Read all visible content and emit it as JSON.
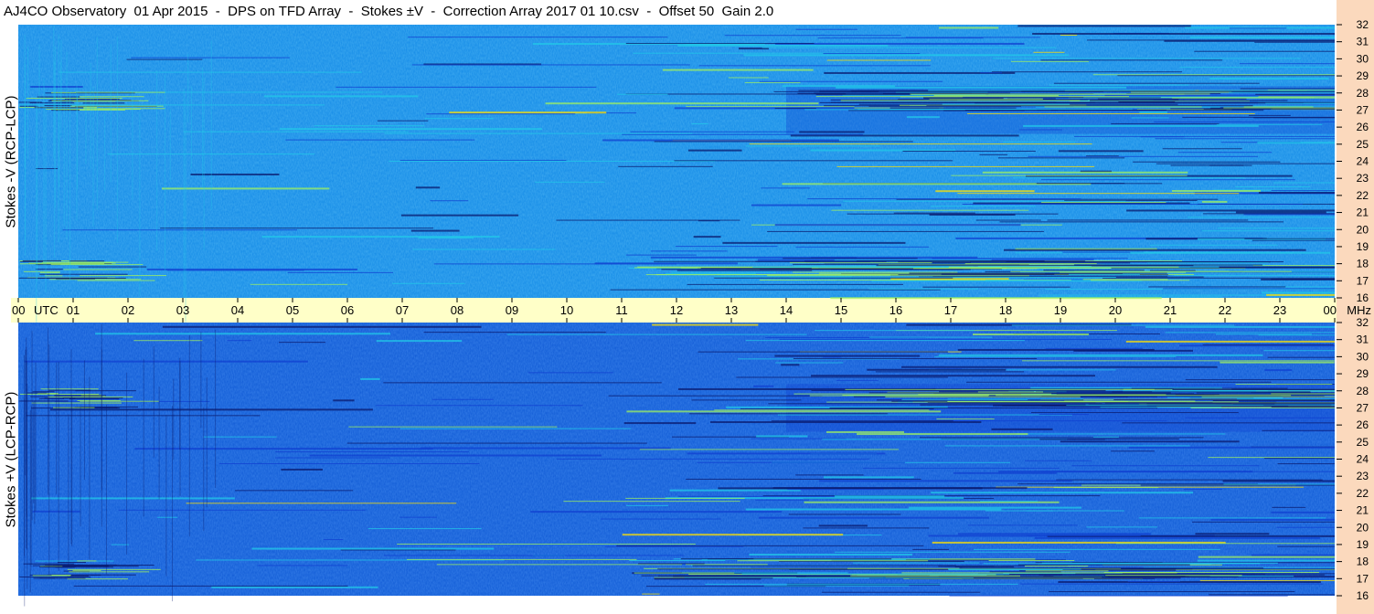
{
  "title": "AJ4CO Observatory  01 Apr 2015  -  DPS on TFD Array  -  Stokes ±V  -  Correction Array 2017 01 10.csv  -  Offset 50  Gain 2.0",
  "chart_data": [
    {
      "type": "heatmap",
      "panel": "top",
      "ylabel": "Stokes -V (RCP-LCP)",
      "y_unit": "MHz",
      "ylim": [
        16,
        32
      ],
      "y_ticks": [
        16,
        17,
        18,
        19,
        20,
        21,
        22,
        23,
        24,
        25,
        26,
        27,
        28,
        29,
        30,
        31,
        32
      ],
      "x_ticks": [
        "00",
        "01",
        "02",
        "03",
        "04",
        "05",
        "06",
        "07",
        "08",
        "09",
        "10",
        "11",
        "12",
        "13",
        "14",
        "15",
        "16",
        "17",
        "18",
        "19",
        "20",
        "21",
        "22",
        "23",
        "00"
      ],
      "base_color": "#1a8fe8",
      "colormap": [
        "#0a1a6e",
        "#1040d0",
        "#1a8fe8",
        "#22c8e8",
        "#9ff060",
        "#ffe000"
      ]
    },
    {
      "type": "heatmap",
      "panel": "bottom",
      "ylabel": "Stokes +V (LCP-RCP)",
      "y_unit": "MHz",
      "ylim": [
        16,
        32
      ],
      "y_ticks": [
        16,
        17,
        18,
        19,
        20,
        21,
        22,
        23,
        24,
        25,
        26,
        27,
        28,
        29,
        30,
        31,
        32
      ],
      "x_ticks": [
        "00",
        "01",
        "02",
        "03",
        "04",
        "05",
        "06",
        "07",
        "08",
        "09",
        "10",
        "11",
        "12",
        "13",
        "14",
        "15",
        "16",
        "17",
        "18",
        "19",
        "20",
        "21",
        "22",
        "23",
        "00"
      ],
      "base_color": "#1660d8",
      "colormap": [
        "#0a1a6e",
        "#1040d0",
        "#1660d8",
        "#22c8e8",
        "#9ff060",
        "#ffe000"
      ]
    }
  ],
  "time_axis": {
    "tz_label": "UTC",
    "unit_label": "MHz",
    "hours": [
      "00",
      "01",
      "02",
      "03",
      "04",
      "05",
      "06",
      "07",
      "08",
      "09",
      "10",
      "11",
      "12",
      "13",
      "14",
      "15",
      "16",
      "17",
      "18",
      "19",
      "20",
      "21",
      "22",
      "23",
      "00"
    ]
  }
}
